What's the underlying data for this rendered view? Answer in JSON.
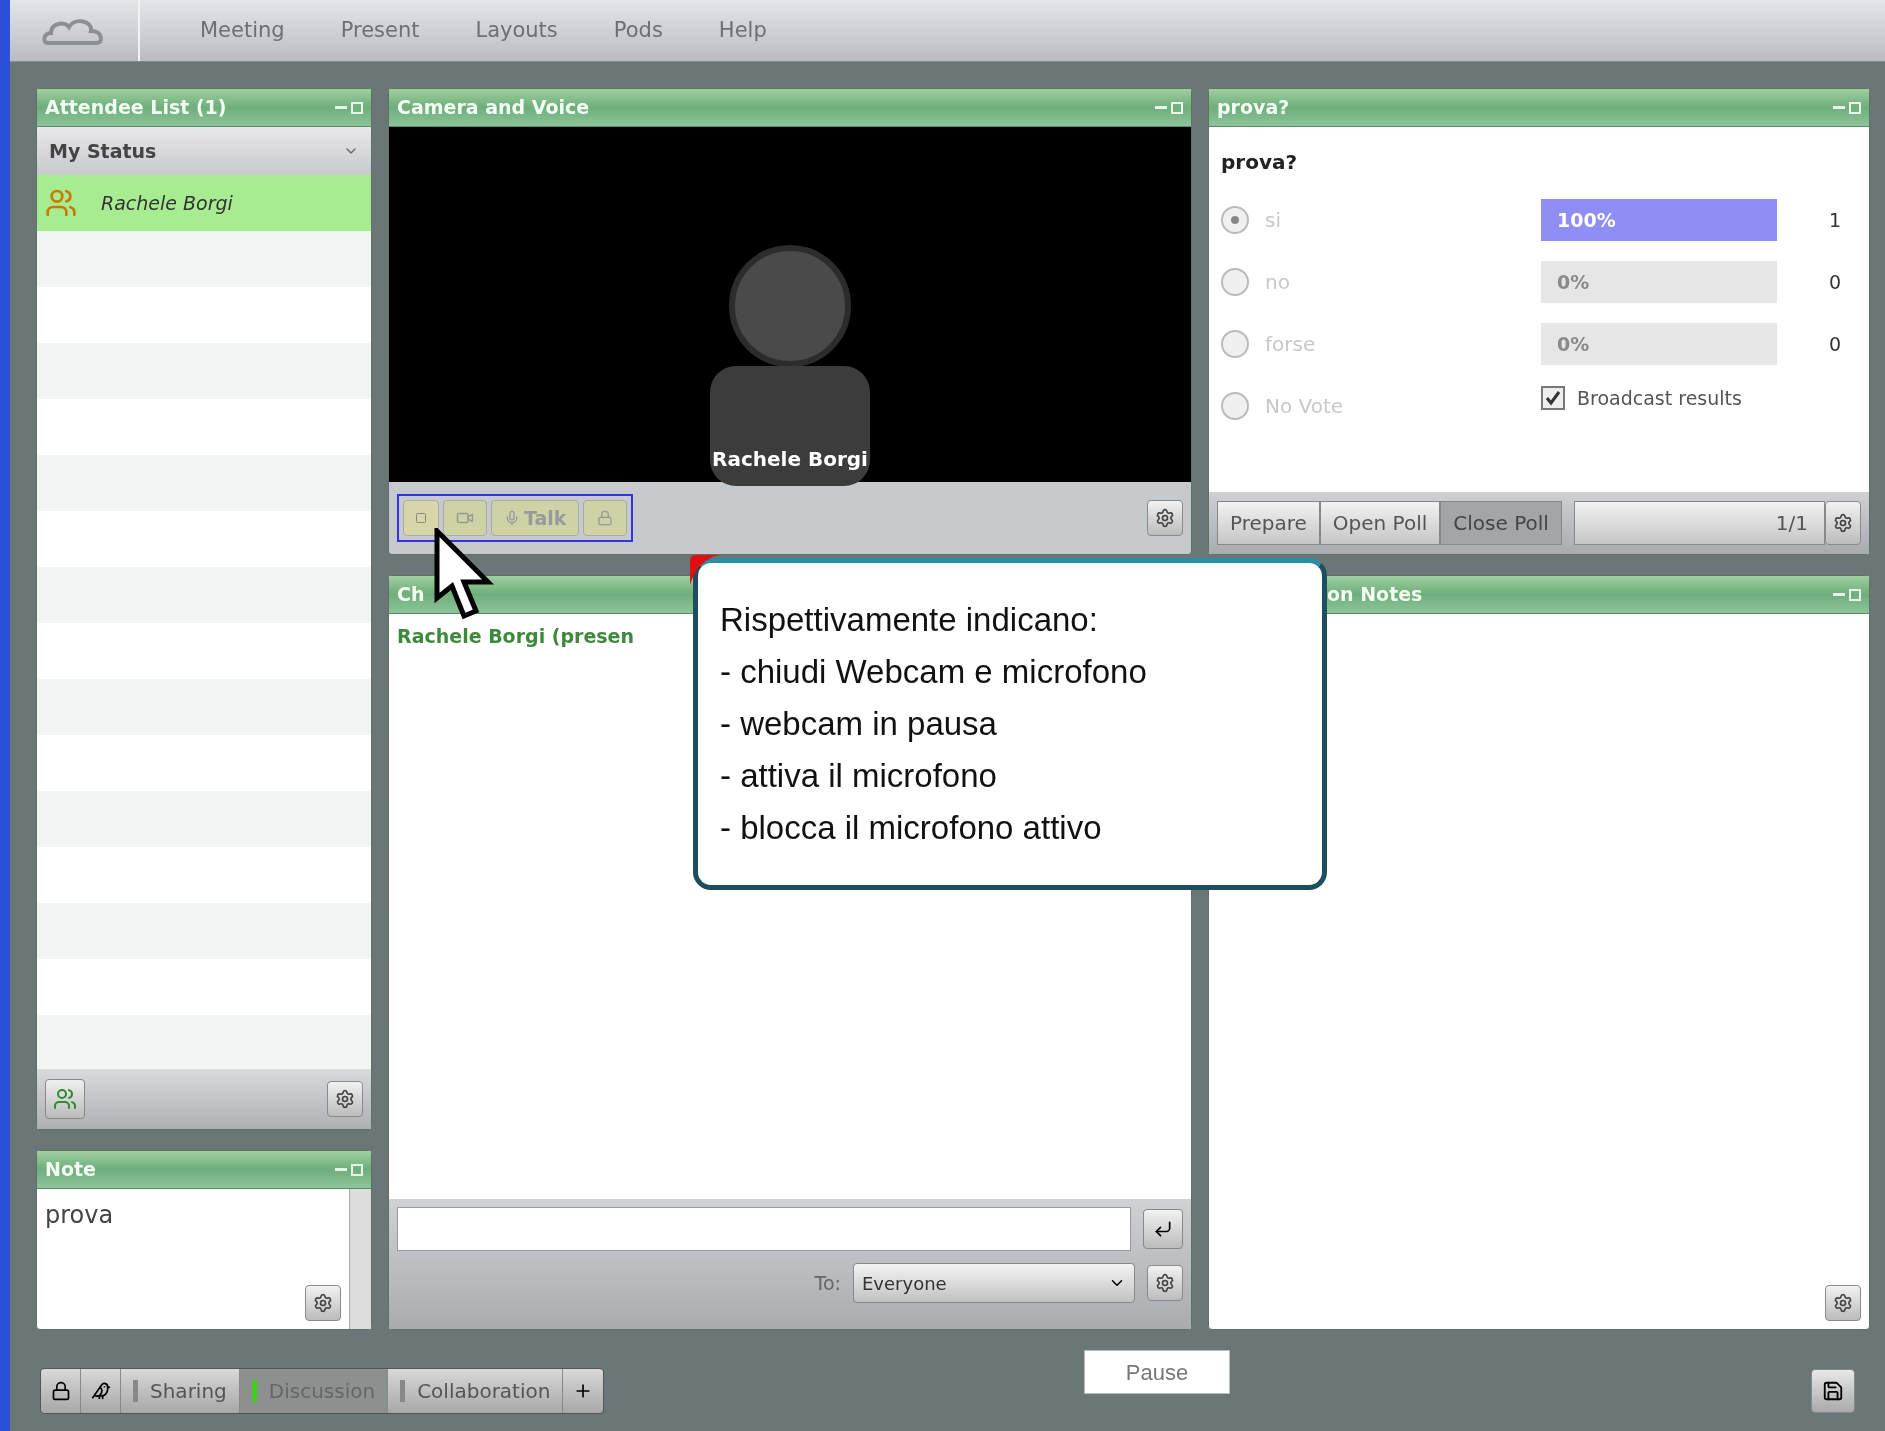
{
  "menu": {
    "items": [
      "Meeting",
      "Present",
      "Layouts",
      "Pods",
      "Help"
    ]
  },
  "attendees": {
    "title": "Attendee List (1)",
    "status": "My Status",
    "rows": [
      {
        "name": "Rachele Borgi",
        "selected": true
      }
    ]
  },
  "note": {
    "title": "Note",
    "text": "prova"
  },
  "camera": {
    "title": "Camera and Voice",
    "video_label": "Rachele Borgi",
    "talk": "Talk"
  },
  "chat": {
    "title": "Ch",
    "messages": [
      "Rachele Borgi (presen"
    ],
    "to_label": "To:",
    "recipient": "Everyone"
  },
  "poll": {
    "title": "prova?",
    "question": "prova?",
    "options": [
      {
        "label": "si",
        "selected": true,
        "percent": "100%",
        "level": 1,
        "count": "1"
      },
      {
        "label": "no",
        "selected": false,
        "percent": "0%",
        "level": 0,
        "count": "0"
      },
      {
        "label": "forse",
        "selected": false,
        "percent": "0%",
        "level": 0,
        "count": "0"
      },
      {
        "label": "No Vote",
        "selected": false
      }
    ],
    "broadcast": {
      "label": "Broadcast results",
      "checked": true
    },
    "buttons": [
      {
        "label": "Prepare",
        "selected": false
      },
      {
        "label": "Open Poll",
        "selected": false
      },
      {
        "label": "Close Poll",
        "selected": true
      }
    ],
    "page": "1/1"
  },
  "notes": {
    "title": "on Notes"
  },
  "layouts": {
    "tabs": [
      {
        "label": "Sharing",
        "selected": false
      },
      {
        "label": "Discussion",
        "selected": true
      },
      {
        "label": "Collaboration",
        "selected": false
      }
    ]
  },
  "tooltip": {
    "text": "Pause"
  },
  "callout": {
    "lines": [
      "Rispettivamente indicano:",
      "- chiudi Webcam e microfono",
      "- webcam in pausa",
      "- attiva il microfono",
      "- blocca il microfono attivo"
    ]
  }
}
